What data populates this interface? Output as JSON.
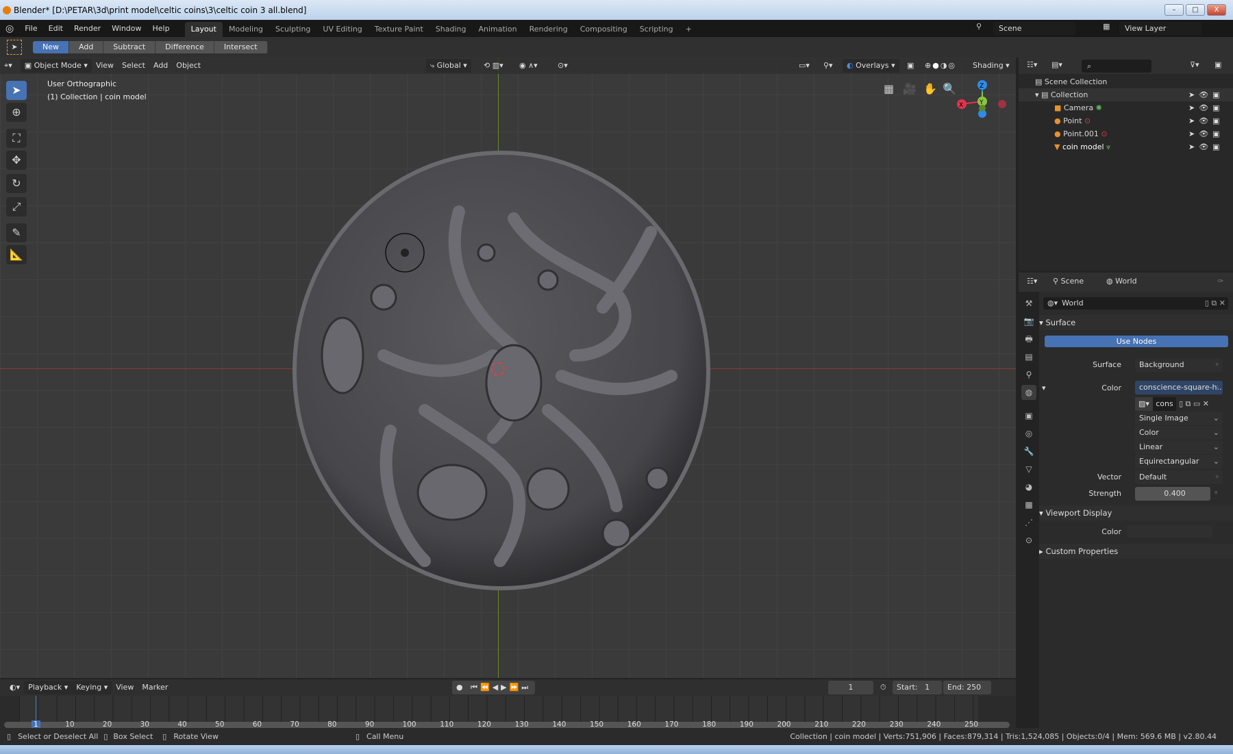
{
  "window": {
    "title": "Blender* [D:\\PETAR\\3d\\print model\\celtic coins\\3\\celtic coin 3 all.blend]",
    "min": "–",
    "max": "□",
    "close": "X"
  },
  "menu": [
    "File",
    "Edit",
    "Render",
    "Window",
    "Help"
  ],
  "workspaces": [
    "Layout",
    "Modeling",
    "Sculpting",
    "UV Editing",
    "Texture Paint",
    "Shading",
    "Animation",
    "Rendering",
    "Compositing",
    "Scripting",
    "+"
  ],
  "scene": {
    "scene_name": "Scene",
    "view_layer": "View Layer"
  },
  "tool_header": {
    "modes": [
      "New",
      "Add",
      "Subtract",
      "Difference",
      "Intersect"
    ]
  },
  "viewport_header": {
    "mode": "Object Mode",
    "menus": [
      "View",
      "Select",
      "Add",
      "Object"
    ],
    "orientation": "Global",
    "overlays": "Overlays",
    "shading": "Shading"
  },
  "viewport": {
    "view_name": "User Orthographic",
    "context": "(1) Collection | coin model",
    "gizmo": {
      "x": "X",
      "y": "Y",
      "z": "Z"
    }
  },
  "outliner": {
    "root": "Scene Collection",
    "collection": "Collection",
    "items": [
      {
        "name": "Camera"
      },
      {
        "name": "Point"
      },
      {
        "name": "Point.001"
      },
      {
        "name": "coin model"
      }
    ]
  },
  "properties": {
    "breadcrumb": [
      "Scene",
      "World"
    ],
    "world_name": "World",
    "surface_section": "Surface",
    "use_nodes": "Use Nodes",
    "surface_label": "Surface",
    "surface_value": "Background",
    "color_label": "Color",
    "color_value": "conscience-square-h..",
    "image_name": "cons",
    "dropdowns": [
      "Single Image",
      "Color",
      "Linear",
      "Equirectangular"
    ],
    "vector_label": "Vector",
    "vector_value": "Default",
    "strength_label": "Strength",
    "strength_value": "0.400",
    "viewport_display": "Viewport Display",
    "vd_color_label": "Color",
    "custom_props": "Custom Properties"
  },
  "timeline": {
    "menus": [
      "Playback",
      "Keying",
      "View",
      "Marker"
    ],
    "current_frame": "1",
    "start_label": "Start:",
    "start": "1",
    "end_label": "End:",
    "end": "250",
    "ticks": [
      "1",
      "10",
      "20",
      "30",
      "40",
      "50",
      "60",
      "70",
      "80",
      "90",
      "100",
      "110",
      "120",
      "130",
      "140",
      "150",
      "160",
      "170",
      "180",
      "190",
      "200",
      "210",
      "220",
      "230",
      "240",
      "250"
    ]
  },
  "status": {
    "hints": [
      "Select or Deselect All",
      "Box Select",
      "Rotate View",
      "Call Menu"
    ],
    "info": "Collection | coin model | Verts:751,906 | Faces:879,314 | Tris:1,524,085 | Objects:0/4 | Mem: 569.6 MB | v2.80.44"
  },
  "colors": {
    "accent": "#4772b3",
    "x_axis": "#e5334b",
    "y_axis": "#8bc53f",
    "z_axis": "#2d8ceb"
  }
}
